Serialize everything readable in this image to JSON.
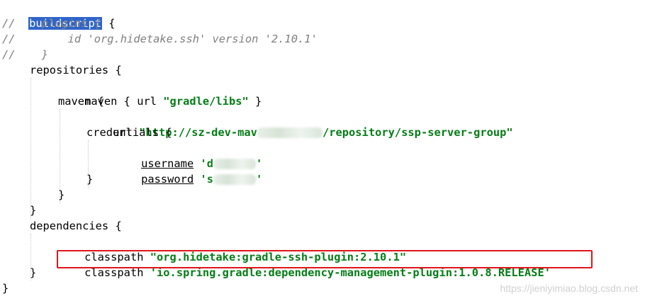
{
  "code": {
    "l1": {
      "head": "buildscript",
      "tail": " {"
    },
    "l2": "//    plugins {",
    "l3": "//        id 'org.hidetake.ssh' version '2.10.1'",
    "l4": "//    }",
    "l5": "repositories {",
    "l6": {
      "a": "maven { url ",
      "s": "\"gradle/libs\"",
      "b": " }"
    },
    "l7": "maven {",
    "l8": {
      "a": "url ",
      "s1": "\"http://sz-dev-mav",
      "s2": "/repository/ssp-server-group\""
    },
    "l9": "credentials {",
    "l10": {
      "k": "username",
      "s1": "'d",
      "s2": "'"
    },
    "l11": {
      "k": "password",
      "s1": "'s",
      "s2": "'"
    },
    "l12": "}",
    "l13": "}",
    "l14": "}",
    "l15": "dependencies {",
    "l16": {
      "a": "classpath ",
      "s": "\"org.hidetake:gradle-ssh-plugin:2.10.1\""
    },
    "l17": {
      "a": "classpath ",
      "s": "'io.spring.gradle:dependency-management-plugin:1.0.8.RELEASE'"
    },
    "l18": "}",
    "l19": "}"
  },
  "watermark": "https://jieniyimiao.blog.csdn.net",
  "colors": {
    "string": "#067d17",
    "comment": "#808080",
    "selection": "#2f65ca",
    "highlight_box": "#e0151b"
  }
}
